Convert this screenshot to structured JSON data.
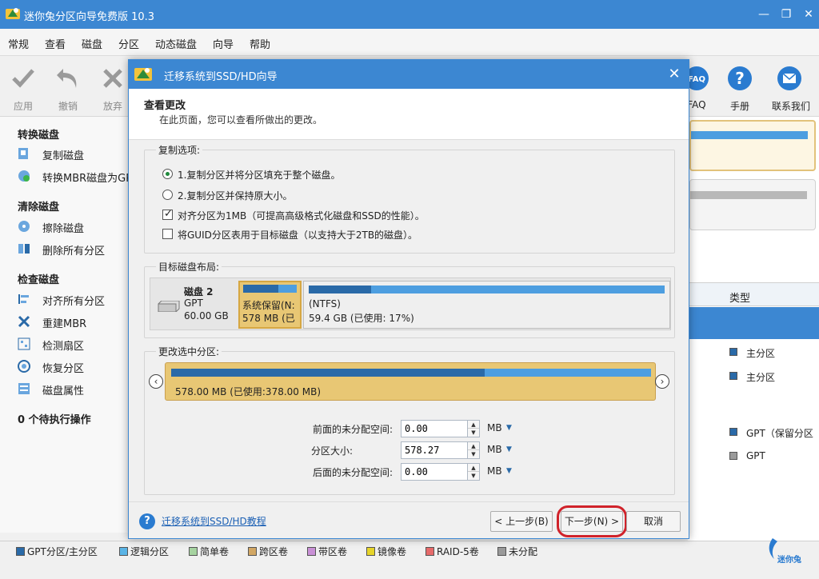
{
  "app": {
    "title": "迷你兔分区向导免费版 10.3",
    "min": "—",
    "max": "❐",
    "close": "✕"
  },
  "menu": [
    "常规",
    "查看",
    "磁盘",
    "分区",
    "动态磁盘",
    "向导",
    "帮助"
  ],
  "toolbar": {
    "apply": "应用",
    "undo": "撤销",
    "discard": "放弃",
    "faq": "FAQ",
    "manual": "手册",
    "contact": "联系我们"
  },
  "sidebar": {
    "convert_section": "转换磁盘",
    "copy_disk": "复制磁盘",
    "convert_mbr": "转换MBR磁盘为GPT",
    "clean_section": "清除磁盘",
    "wipe_disk": "擦除磁盘",
    "delete_all": "删除所有分区",
    "check_section": "检查磁盘",
    "align_all": "对齐所有分区",
    "rebuild_mbr": "重建MBR",
    "surface_test": "检测扇区",
    "recover_partition": "恢复分区",
    "disk_properties": "磁盘属性",
    "pending": "0 个待执行操作"
  },
  "background": {
    "type_header": "类型",
    "row1": "主分区",
    "row2": "主分区",
    "row3": "GPT（保留分区",
    "row4": "GPT"
  },
  "legend": [
    "GPT分区/主分区",
    "逻辑分区",
    "简单卷",
    "跨区卷",
    "带区卷",
    "镜像卷",
    "RAID-5卷",
    "未分配"
  ],
  "legend_colors": [
    "#2a6aa8",
    "#5ab4e6",
    "#a6d3a0",
    "#d2a764",
    "#c990d6",
    "#e6d42a",
    "#e66a6a",
    "#9a9a9a"
  ],
  "brand": "迷你兔",
  "dialog": {
    "title": "迁移系统到SSD/HD向导",
    "close": "✕",
    "header_title": "查看更改",
    "header_sub": "在此页面，您可以查看所做出的更改。",
    "copy_options": {
      "title": "复制选项:",
      "opt1": "1.复制分区并将分区填充于整个磁盘。",
      "opt2": "2.复制分区并保持原大小。",
      "opt3": "对齐分区为1MB（可提高高级格式化磁盘和SSD的性能）。",
      "opt4": "将GUID分区表用于目标磁盘（以支持大于2TB的磁盘）。"
    },
    "target_layout": {
      "title": "目标磁盘布局:",
      "disk_name": "磁盘 2",
      "disk_type": "GPT",
      "disk_size": "60.00 GB",
      "part1_label": "系统保留(N:",
      "part1_size": "578 MB (已",
      "part2_label": "(NTFS)",
      "part2_size": "59.4 GB (已使用: 17%)"
    },
    "change_partition": {
      "title": "更改选中分区:",
      "partition_label": "578.00 MB (已使用:378.00 MB)",
      "left_arrow": "‹",
      "right_arrow": "›",
      "before_label": "前面的未分配空间:",
      "before_value": "0.00",
      "size_label": "分区大小:",
      "size_value": "578.27",
      "after_label": "后面的未分配空间:",
      "after_value": "0.00",
      "unit": "MB"
    },
    "footer": {
      "help_link": "迁移系统到SSD/HD教程",
      "back": "< 上一步(B)",
      "next": "下一步(N) >",
      "cancel": "取消"
    }
  }
}
